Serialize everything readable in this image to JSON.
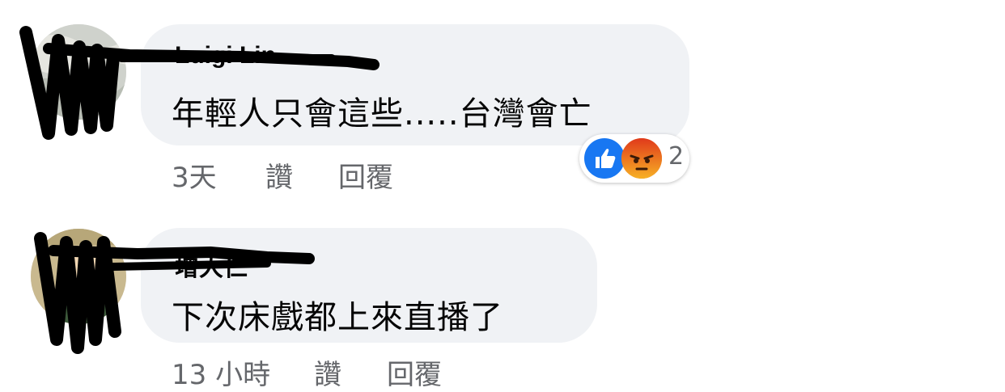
{
  "comments": [
    {
      "author": "Luigi Lin",
      "text": "年輕人只會這些.....台灣會亡",
      "time": "3天",
      "like_label": "讚",
      "reply_label": "回覆",
      "reactions": {
        "types": [
          "like",
          "angry"
        ],
        "count": "2"
      }
    },
    {
      "author": "增大仁",
      "text": "下次床戲都上來直播了",
      "time": "13 小時",
      "like_label": "讚",
      "reply_label": "回覆"
    }
  ],
  "colors": {
    "bubble": "#f0f2f5",
    "meta_text": "#65676b",
    "like_blue": "#1877f2",
    "angry_orange": "#e9710f"
  },
  "icons": [
    "like-reaction-icon",
    "angry-reaction-icon"
  ]
}
